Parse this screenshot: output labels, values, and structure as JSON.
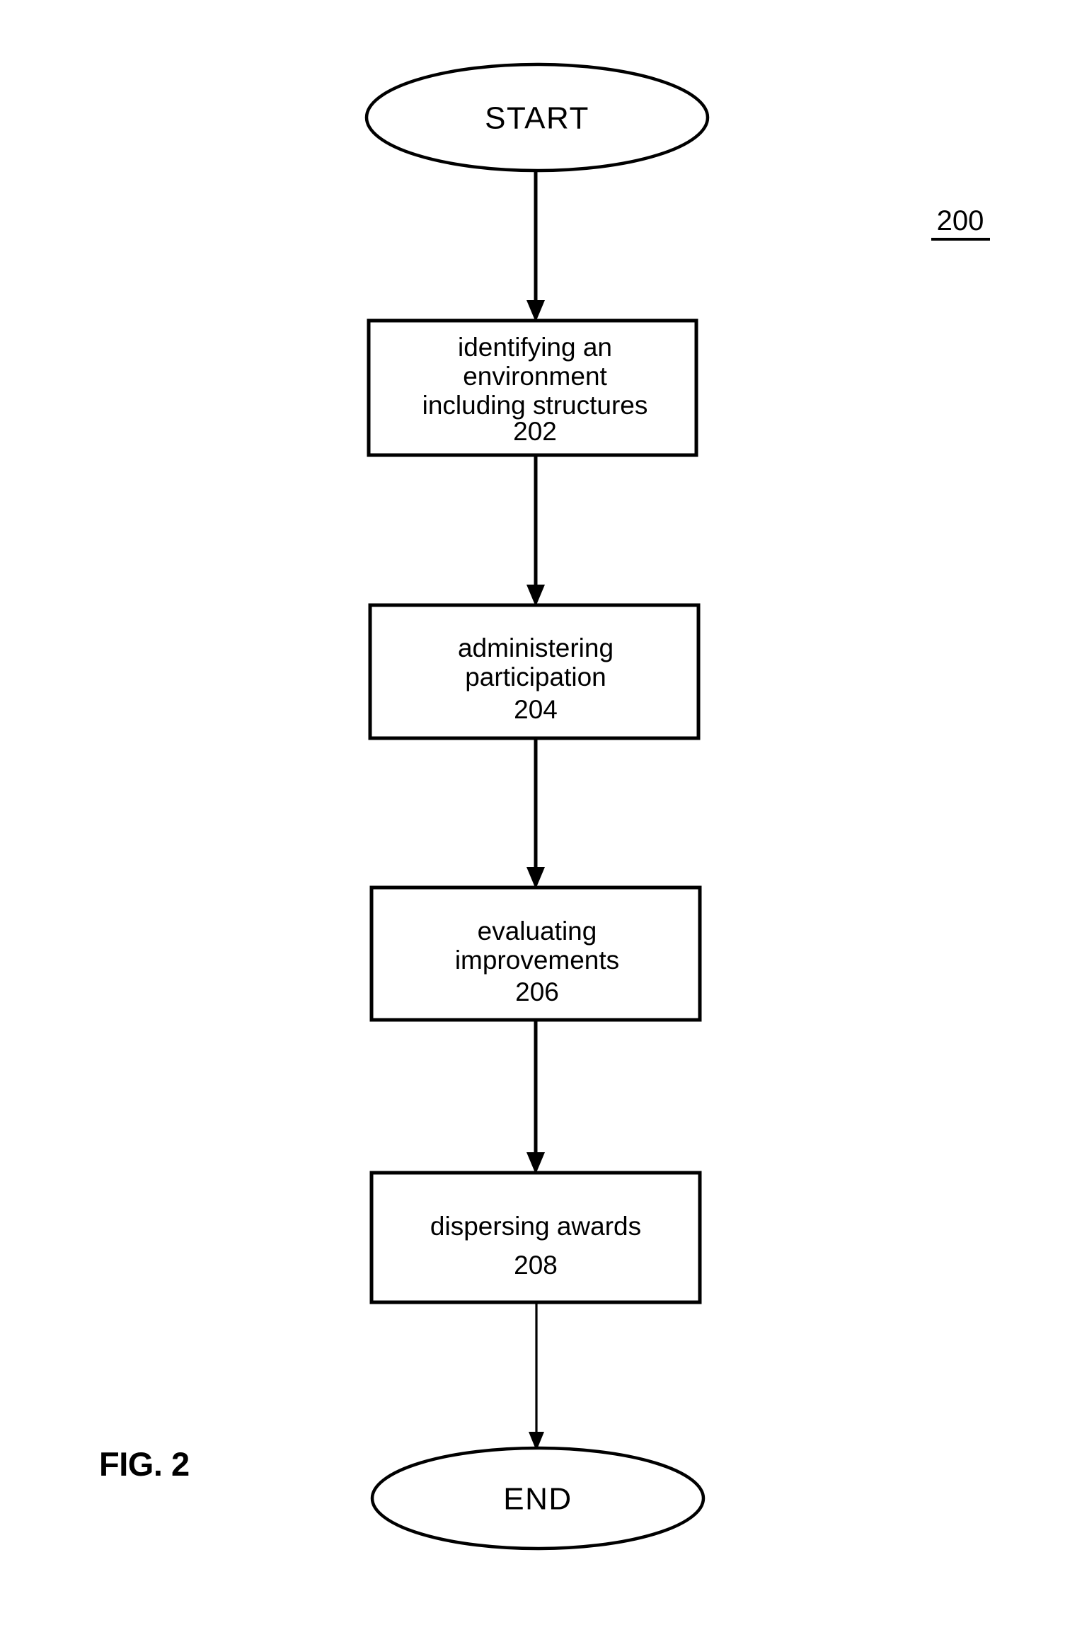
{
  "figure": {
    "caption": "FIG. 2",
    "diagram_reference": "200"
  },
  "flowchart": {
    "start": {
      "label": "START",
      "shape": "ellipse"
    },
    "end": {
      "label": "END",
      "shape": "ellipse"
    },
    "steps": [
      {
        "id": "step-202",
        "shape": "rectangle",
        "lines": [
          "identifying an",
          "environment",
          "including structures"
        ],
        "reference": "202"
      },
      {
        "id": "step-204",
        "shape": "rectangle",
        "lines": [
          "administering",
          "participation"
        ],
        "reference": "204"
      },
      {
        "id": "step-206",
        "shape": "rectangle",
        "lines": [
          "evaluating",
          "improvements"
        ],
        "reference": "206"
      },
      {
        "id": "step-208",
        "shape": "rectangle",
        "lines": [
          "dispersing awards"
        ],
        "reference": "208"
      }
    ],
    "connectors": [
      {
        "id": "connector-start-202",
        "from": "start",
        "to": "step-202"
      },
      {
        "id": "connector-202-204",
        "from": "step-202",
        "to": "step-204"
      },
      {
        "id": "connector-204-206",
        "from": "step-204",
        "to": "step-206"
      },
      {
        "id": "connector-206-208",
        "from": "step-206",
        "to": "step-208"
      },
      {
        "id": "connector-208-end",
        "from": "step-208",
        "to": "end"
      }
    ]
  },
  "colors": {
    "ink": "#000000",
    "paper": "#ffffff"
  }
}
